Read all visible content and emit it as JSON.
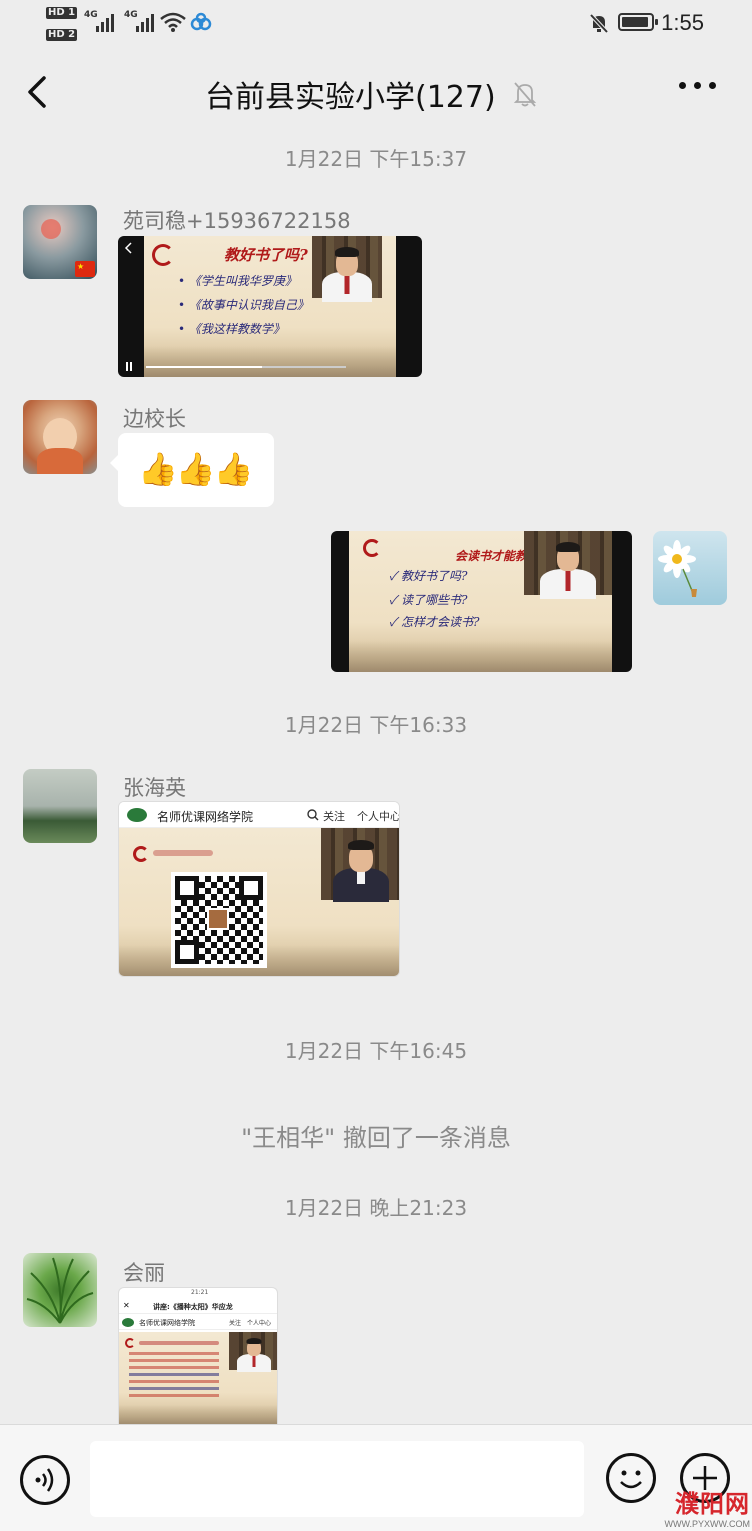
{
  "status_bar": {
    "sim1": "HD 1",
    "sim2": "HD 2",
    "net1": "4G",
    "net2": "4G",
    "time": "1:55"
  },
  "header": {
    "title": "台前县实验小学(127)",
    "back_icon": "chevron-left-icon",
    "mute_icon": "bell-off-icon",
    "more_icon": "more-dots-icon"
  },
  "messages": [
    {
      "type": "timestamp",
      "text": "1月22日 下午15:37"
    },
    {
      "type": "video",
      "direction": "in",
      "sender": "苑司稳+15936722158",
      "slide": {
        "heading": "教好书了吗?",
        "bullets": [
          "《学生叫我华罗庚》",
          "《故事中认识我自己》",
          "《我这样教数学》"
        ]
      }
    },
    {
      "type": "emoji",
      "direction": "in",
      "sender": "边校长",
      "content": "👍👍👍"
    },
    {
      "type": "video",
      "direction": "out",
      "slide": {
        "heading": "会读书才能教好书",
        "bullets": [
          "✓ 教好书了吗?",
          "✓ 读了哪些书?",
          "✓ 怎样才会读书?"
        ]
      }
    },
    {
      "type": "timestamp",
      "text": "1月22日 下午16:33"
    },
    {
      "type": "image",
      "direction": "in",
      "sender": "张海英",
      "page": {
        "site_name": "名师优课网络学院",
        "follow": "关注",
        "center": "个人中心"
      }
    },
    {
      "type": "timestamp",
      "text": "1月22日 下午16:45"
    },
    {
      "type": "system",
      "text": "\"王相华\" 撤回了一条消息"
    },
    {
      "type": "timestamp",
      "text": "1月22日 晚上21:23"
    },
    {
      "type": "image",
      "direction": "in",
      "sender": "会丽",
      "page": {
        "status_time": "21:21",
        "lecture_title": "讲座:《播种太阳》华应龙",
        "site_name": "名师优课网络学院",
        "follow": "关注",
        "center": "个人中心"
      }
    }
  ],
  "input_bar": {
    "voice_icon": "voice-icon",
    "emoji_icon": "emoji-icon",
    "plus_icon": "plus-icon",
    "value": ""
  },
  "watermark": {
    "text": "濮阳网",
    "url": "WWW.PYXWW.COM"
  },
  "colors": {
    "background": "#ededed",
    "bubble": "#ffffff",
    "watermark": "#d6262c"
  }
}
